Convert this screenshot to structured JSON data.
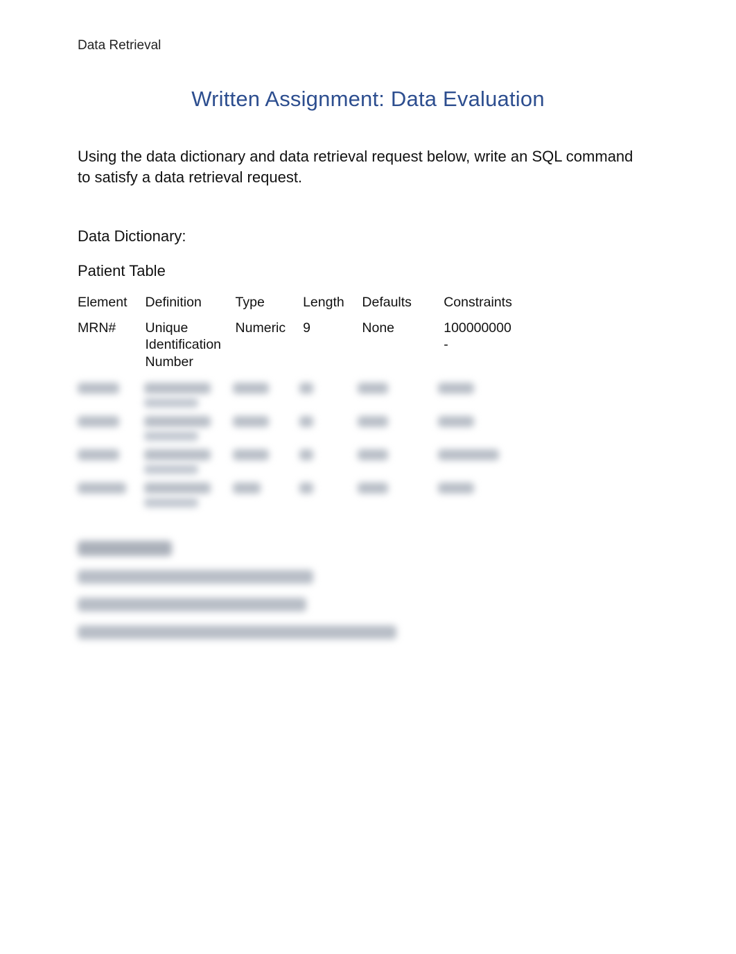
{
  "header": {
    "running": "Data Retrieval"
  },
  "title": "Written Assignment: Data Evaluation",
  "intro": "Using the data dictionary and data retrieval request below, write an SQL command to satisfy a data retrieval request.",
  "sections": {
    "data_dictionary_label": "Data Dictionary:",
    "table_name": "Patient Table"
  },
  "dictionary": {
    "headers": {
      "element": "Element",
      "definition": "Definition",
      "type": "Type",
      "length": "Length",
      "defaults": "Defaults",
      "constraints": "Constraints"
    },
    "rows": [
      {
        "element": "MRN#",
        "definition": "Unique Identification Number",
        "type": "Numeric",
        "length": "9",
        "defaults": "None",
        "constraints": "100000000 -"
      }
    ]
  }
}
